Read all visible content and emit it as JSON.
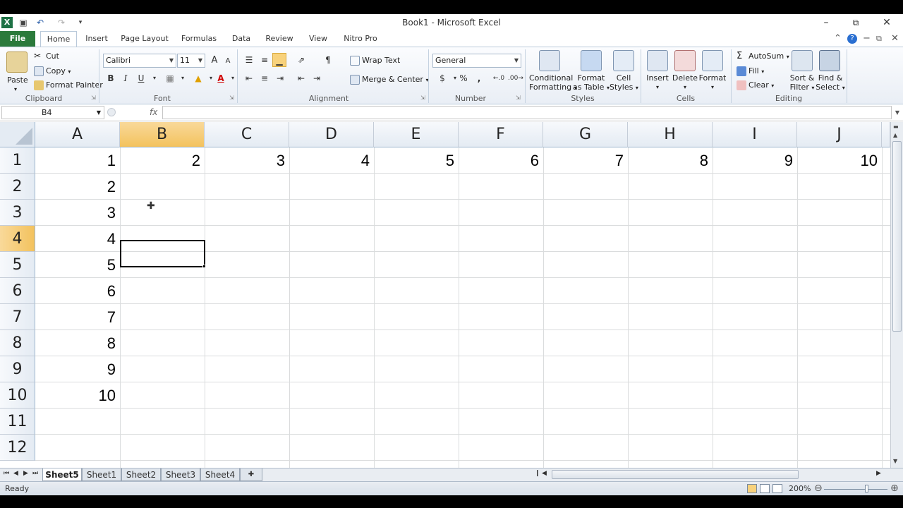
{
  "window": {
    "title": "Book1 - Microsoft Excel",
    "minimize": "–",
    "restore": "⧉",
    "close": "✕"
  },
  "quick_access": {
    "excel_icon": "X",
    "save": "💾",
    "undo": "↶",
    "redo": "↷",
    "customize": "▾"
  },
  "ribbon_tabs": [
    {
      "label": "File"
    },
    {
      "label": "Home"
    },
    {
      "label": "Insert"
    },
    {
      "label": "Page Layout"
    },
    {
      "label": "Formulas"
    },
    {
      "label": "Data"
    },
    {
      "label": "Review"
    },
    {
      "label": "View"
    },
    {
      "label": "Nitro Pro"
    }
  ],
  "ribbon": {
    "clipboard": {
      "paste": "Paste",
      "cut": "Cut",
      "copy": "Copy",
      "format_painter": "Format Painter",
      "label": "Clipboard"
    },
    "font": {
      "family": "Calibri",
      "size": "11",
      "grow": "A",
      "shrink": "A",
      "bold": "B",
      "italic": "I",
      "underline": "U",
      "label": "Font"
    },
    "alignment": {
      "wrap_text": "Wrap Text",
      "merge_center": "Merge & Center",
      "label": "Alignment"
    },
    "number": {
      "format": "General",
      "currency": "$",
      "percent": "%",
      "comma": ",",
      "label": "Number"
    },
    "styles": {
      "conditional": [
        "Conditional",
        "Formatting"
      ],
      "format_table": [
        "Format",
        "as Table"
      ],
      "cell_styles": [
        "Cell",
        "Styles"
      ],
      "label": "Styles"
    },
    "cells": {
      "insert": "Insert",
      "delete": "Delete",
      "format": "Format",
      "label": "Cells"
    },
    "editing": {
      "autosum": "AutoSum",
      "fill": "Fill",
      "clear": "Clear",
      "sort_filter": [
        "Sort &",
        "Filter"
      ],
      "find_select": [
        "Find &",
        "Select"
      ],
      "label": "Editing"
    }
  },
  "formula_bar": {
    "name_box": "B4",
    "fx": "fx",
    "value": ""
  },
  "grid": {
    "columns": [
      "A",
      "B",
      "C",
      "D",
      "E",
      "F",
      "G",
      "H",
      "I",
      "J"
    ],
    "rows": [
      "1",
      "2",
      "3",
      "4",
      "5",
      "6",
      "7",
      "8",
      "9",
      "10",
      "11",
      "12"
    ],
    "selected_column": "B",
    "selected_row": "4",
    "row1_values": [
      "1",
      "2",
      "3",
      "4",
      "5",
      "6",
      "7",
      "8",
      "9",
      "10"
    ],
    "colA_values": [
      "1",
      "2",
      "3",
      "4",
      "5",
      "6",
      "7",
      "8",
      "9",
      "10"
    ]
  },
  "sheet_tabs": [
    {
      "label": "Sheet5",
      "active": true
    },
    {
      "label": "Sheet1"
    },
    {
      "label": "Sheet2"
    },
    {
      "label": "Sheet3"
    },
    {
      "label": "Sheet4"
    }
  ],
  "status": {
    "text": "Ready",
    "zoom": "200%"
  },
  "colors": {
    "file_tab": "#2b7a3b",
    "selected_header": "#f3c25d"
  }
}
